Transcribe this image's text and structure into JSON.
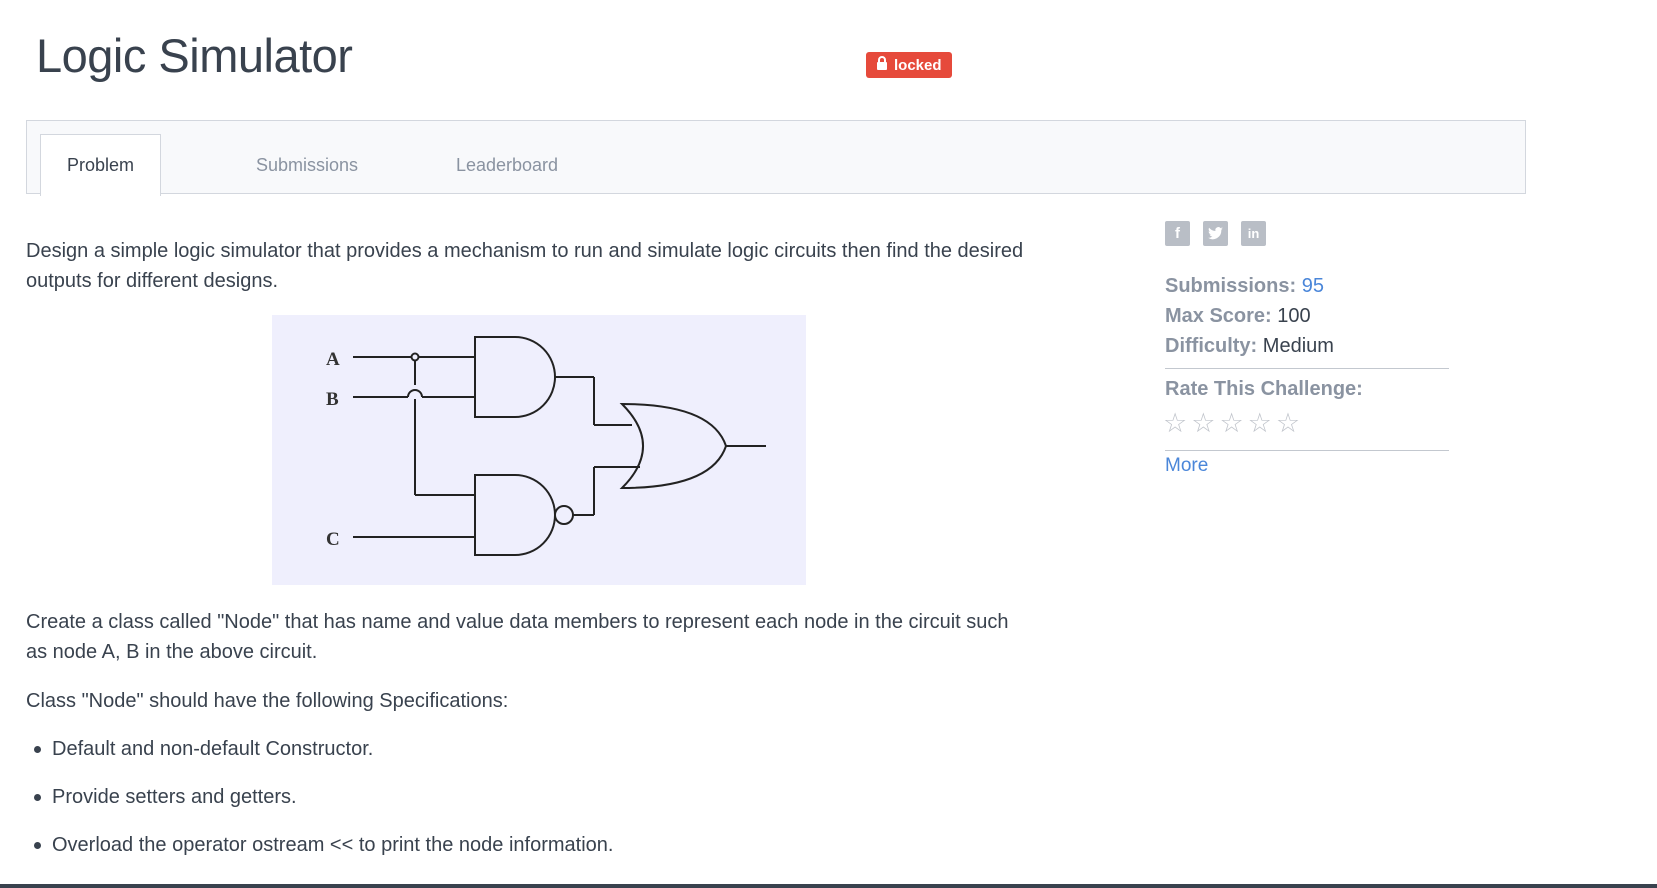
{
  "page": {
    "title": "Logic Simulator",
    "badge": "locked"
  },
  "tabs": [
    {
      "label": "Problem",
      "active": true
    },
    {
      "label": "Submissions",
      "active": false
    },
    {
      "label": "Leaderboard",
      "active": false
    }
  ],
  "content": {
    "intro": "Design a simple logic simulator that provides a mechanism to run and simulate logic circuits then find the desired outputs for different designs.",
    "paragraph2": "Create a class called \"Node\" that has name and value data members to represent each node in the circuit such as node A, B in the above circuit.",
    "paragraph3": "Class \"Node\" should have the following Specifications:",
    "bullets": [
      "Default and non-default Constructor.",
      "Provide setters and getters.",
      "Overload the operator ostream << to print the node information."
    ],
    "circuit_labels": [
      "A",
      "B",
      "C"
    ]
  },
  "sidebar": {
    "social_icons": [
      "facebook-icon",
      "twitter-icon",
      "linkedin-icon"
    ],
    "submissions_label": "Submissions:",
    "submissions_value": "95",
    "max_score_label": "Max Score:",
    "max_score_value": "100",
    "difficulty_label": "Difficulty:",
    "difficulty_value": "Medium",
    "rate_label": "Rate This Challenge:",
    "rating": 0,
    "more_label": "More"
  },
  "colors": {
    "badge": "#e64a3b",
    "link": "#4a86d9",
    "text": "#39424e",
    "muted": "#8a93a1"
  }
}
